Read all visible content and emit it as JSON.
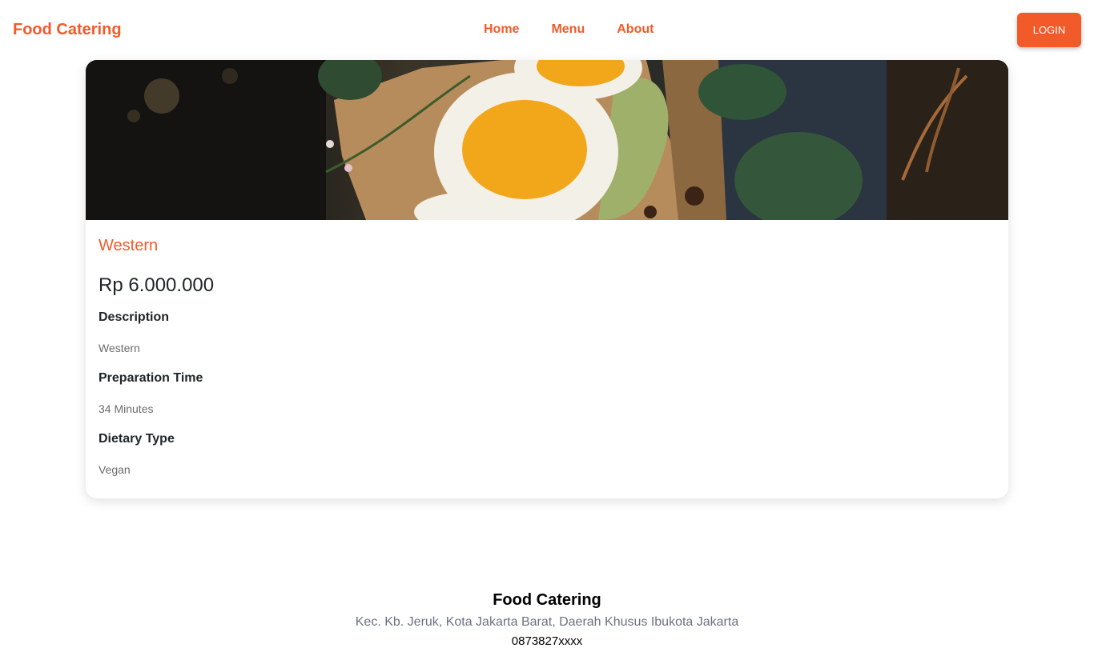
{
  "navbar": {
    "brand": "Food Catering",
    "links": [
      "Home",
      "Menu",
      "About"
    ],
    "login_label": "LOGIN"
  },
  "colors": {
    "accent": "#f25a29"
  },
  "product": {
    "image_icon": "food-photo-egg-toast",
    "title": "Western",
    "price": "Rp 6.000.000",
    "details": [
      {
        "label": "Description",
        "value": "Western"
      },
      {
        "label": "Preparation Time",
        "value": "34 Minutes"
      },
      {
        "label": "Dietary Type",
        "value": "Vegan"
      }
    ]
  },
  "footer": {
    "title": "Food Catering",
    "address": "Kec. Kb. Jeruk, Kota Jakarta Barat, Daerah Khusus Ibukota Jakarta",
    "phone": "0873827xxxx"
  }
}
